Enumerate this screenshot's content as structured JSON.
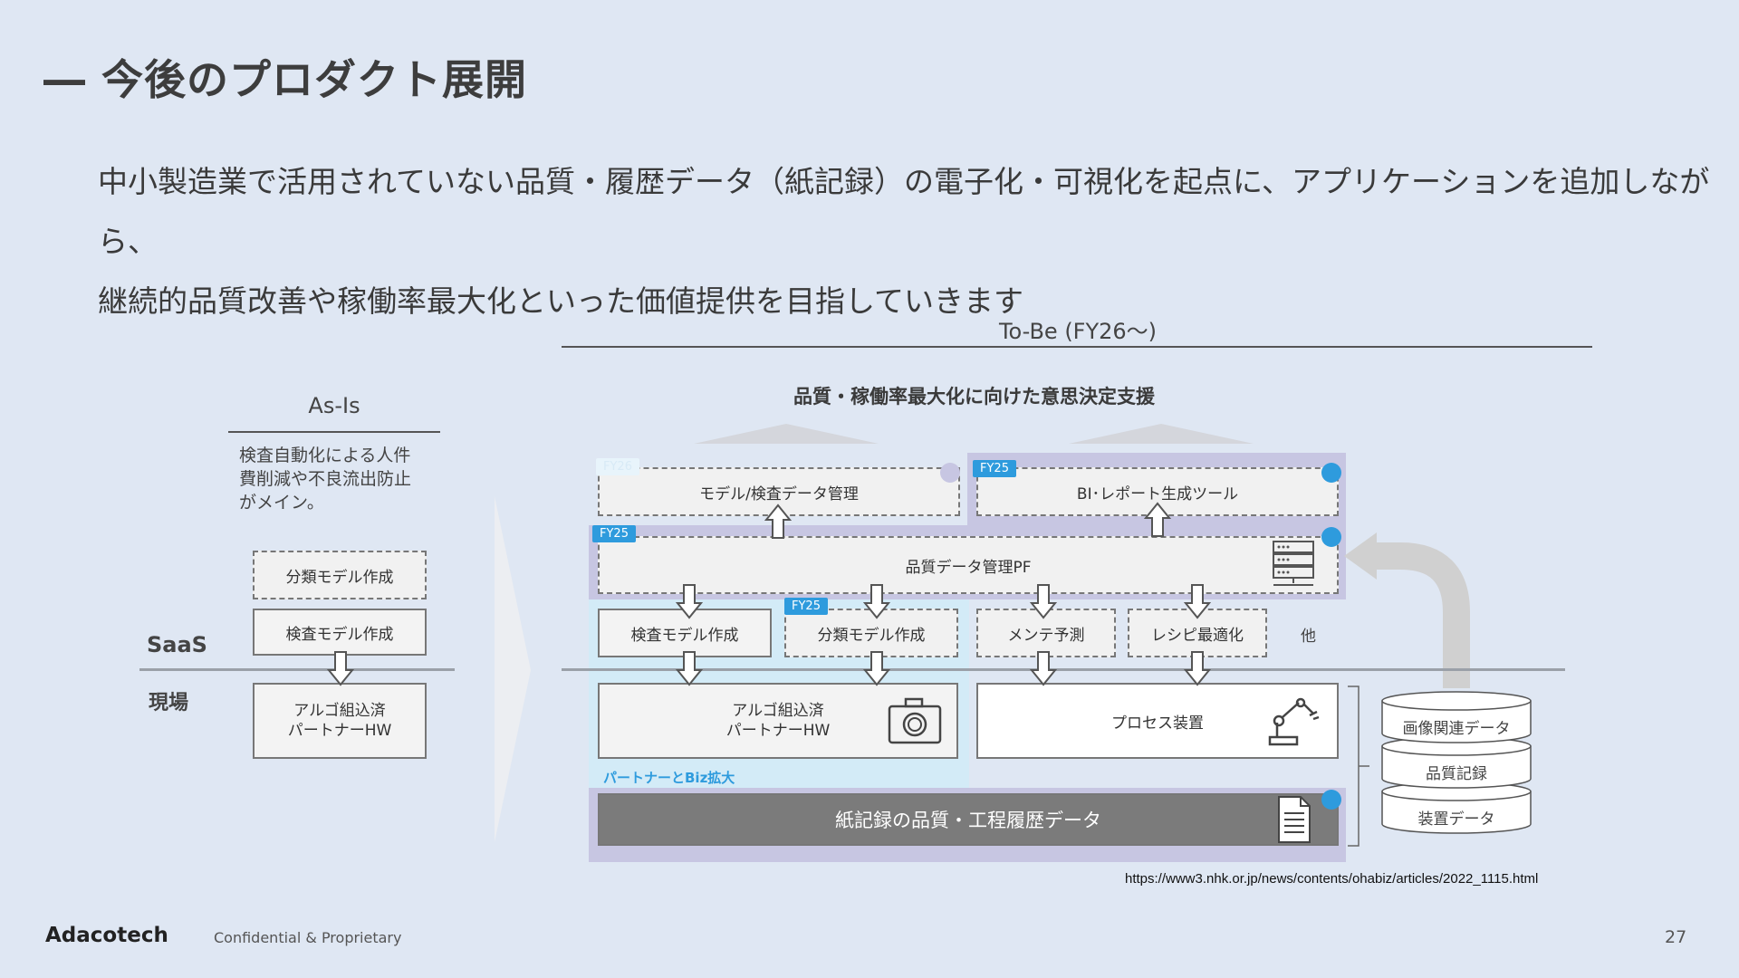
{
  "page": {
    "title": "― 今後のプロダクト展開",
    "subtitle_line1": "中小製造業で活用されていない品質・履歴データ（紙記録）の電子化・可視化を起点に、アプリケーションを追加しながら、",
    "subtitle_line2": "継続的品質改善や稼働率最大化といった価値提供を目指していきます",
    "page_number": "27"
  },
  "as_is": {
    "header": "As-Is",
    "description": [
      "検査自動化による人件",
      "費削減や不良流出防止",
      "がメイン。"
    ],
    "box_classify": "分類モデル作成",
    "box_inspect": "検査モデル作成",
    "box_hw": [
      "アルゴ組込済",
      "パートナーHW"
    ],
    "label_saas": "SaaS",
    "label_genba": "現場"
  },
  "to_be": {
    "header": "To-Be (FY26～)",
    "goal": "品質・稼働率最大化に向けた意思決定支援",
    "model_mgmt": "モデル/検査データ管理",
    "bi_tool": "BI･レポート生成ツール",
    "quality_pf": "品質データ管理PF",
    "inspect_model": "検査モデル作成",
    "classify_model": "分類モデル作成",
    "maintenance": "メンテ予測",
    "recipe": "レシピ最適化",
    "other": "他",
    "partner_hw": [
      "アルゴ組込済",
      "パートナーHW"
    ],
    "process_equipment": "プロセス装置",
    "partner_biz": "パートナーとBiz拡大",
    "paper_records": "紙記録の品質・工程履歴データ",
    "cylinders": [
      "画像関連データ",
      "品質記録",
      "装置データ"
    ],
    "badges": {
      "fy26": "FY26",
      "fy25": "FY25"
    }
  },
  "footer": {
    "logo": "Adacotech",
    "confidential": "Confidential & Proprietary",
    "source_url": "https://www3.nhk.or.jp/news/contents/ohabiz/articles/2022_1115.html"
  },
  "colors": {
    "background": "#dfe7f3",
    "accent_blue": "#2e9bdd",
    "lavender": "#c7c6e2",
    "light_blue": "#d3ebf7",
    "dark_box": "#7b7b7b"
  }
}
